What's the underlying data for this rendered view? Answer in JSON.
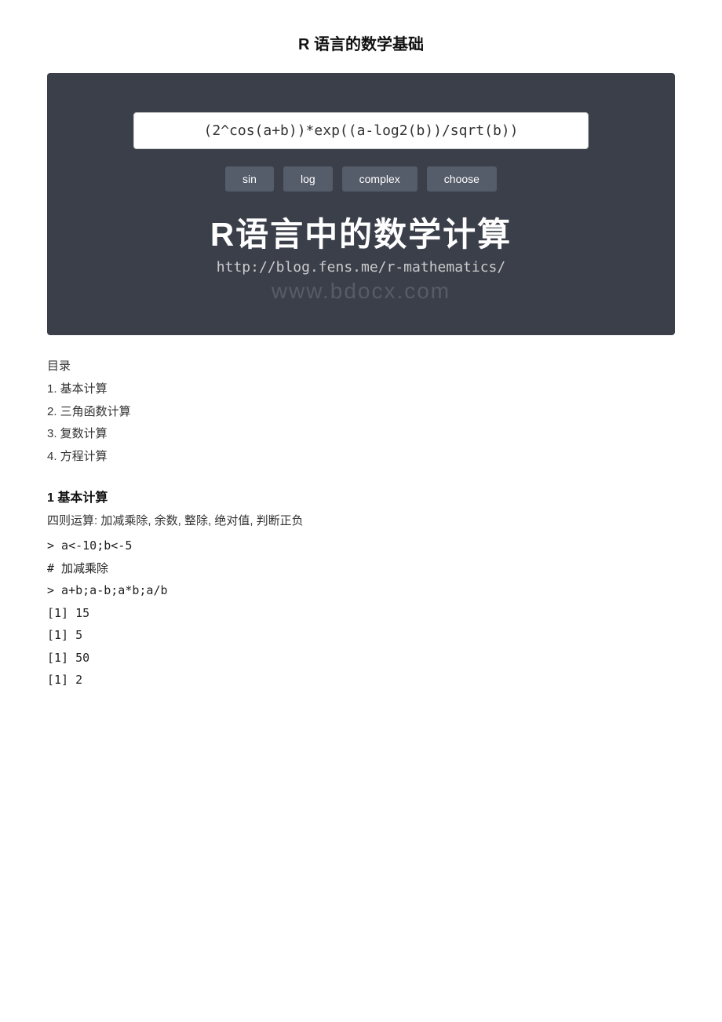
{
  "page": {
    "title": "R 语言的数学基础"
  },
  "banner": {
    "formula": "(2^cos(a+b))*exp((a-log2(b))/sqrt(b))",
    "buttons": [
      {
        "label": "sin",
        "id": "sin-btn"
      },
      {
        "label": "log",
        "id": "log-btn"
      },
      {
        "label": "complex",
        "id": "complex-btn"
      },
      {
        "label": "choose",
        "id": "choose-btn"
      }
    ],
    "main_title": "R语言中的数学计算",
    "subtitle": "http://blog.fens.me/r-mathematics/",
    "watermark": "www.bdocx.com"
  },
  "toc": {
    "heading": "目录",
    "items": [
      "1. 基本计算",
      "2. 三角函数计算",
      "3. 复数计算",
      "4. 方程计算"
    ]
  },
  "section1": {
    "heading": "1 基本计算",
    "description": "四则运算: 加减乘除, 余数, 整除, 绝对值, 判断正负",
    "code_lines": [
      "> a<-10;b<-5",
      "# 加减乘除",
      "> a+b;a-b;a*b;a/b"
    ],
    "output_lines": [
      "[1] 15",
      "[1] 5",
      "[1] 50",
      "[1] 2"
    ]
  }
}
